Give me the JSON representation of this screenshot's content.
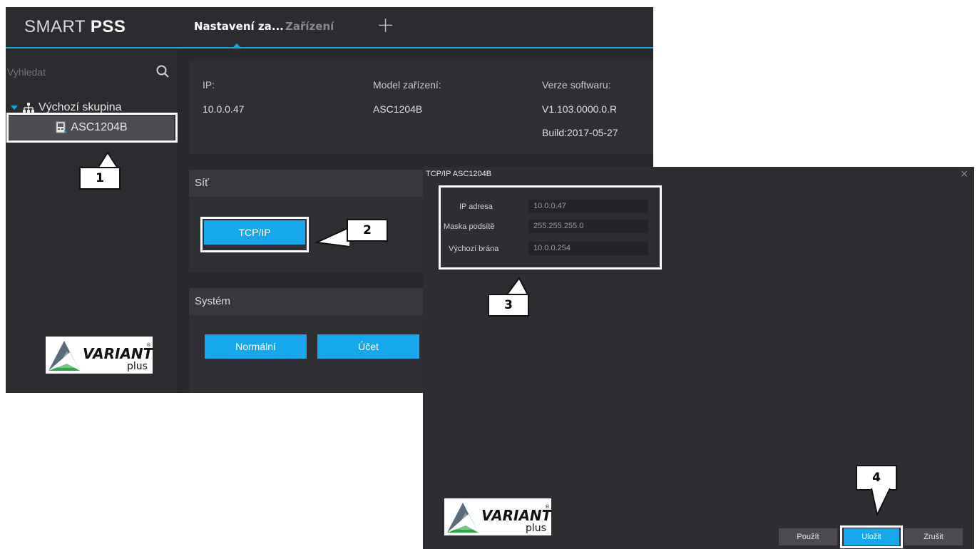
{
  "app": {
    "brand_prefix": "SMART ",
    "brand_bold": "PSS",
    "tabs": [
      {
        "label": "Nastavení za..."
      },
      {
        "label": "Zařízení"
      }
    ],
    "add_tab_symbol": "+"
  },
  "sidebar": {
    "search_placeholder": "Vyhledat",
    "group_label": "Výchozí skupina",
    "device_label": "ASC1204B"
  },
  "device_info": {
    "ip_label": "IP:",
    "ip_value": "10.0.0.47",
    "model_label": "Model zařízení:",
    "model_value": "ASC1204B",
    "version_label": "Verze softwaru:",
    "version_value": "V1.103.0000.0.R",
    "build_value": "Build:2017-05-27"
  },
  "network_section": {
    "title": "Síť",
    "tcpip_button": "TCP/IP"
  },
  "system_section": {
    "title": "Systém",
    "buttons": [
      "Normální",
      "Účet"
    ]
  },
  "dialog": {
    "title": "TCP/IP ASC1204B",
    "close_symbol": "×",
    "fields": [
      {
        "label": "IP adresa",
        "value": "10.0.0.47"
      },
      {
        "label": "Maska podsítě",
        "value": "255.255.255.0"
      },
      {
        "label": "Výchozí brána",
        "value": "10.0.0.254"
      }
    ],
    "buttons": {
      "apply": "Použít",
      "save": "Uložit",
      "cancel": "Zrušit"
    }
  },
  "logo": {
    "word": "VARIANT",
    "sub": "plus",
    "mark": "®"
  },
  "callouts": [
    "1",
    "2",
    "3",
    "4"
  ],
  "colors": {
    "accent": "#17a7ec",
    "background": "#292a2e",
    "panel": "#2e2f33",
    "highlight_frame": "#ffffff"
  }
}
